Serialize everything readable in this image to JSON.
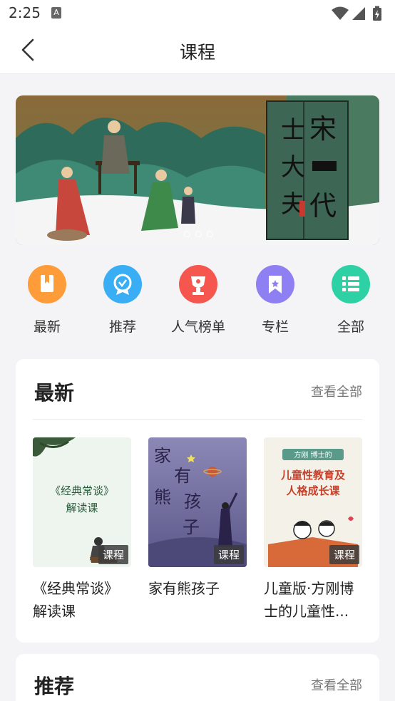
{
  "status": {
    "time": "2:25",
    "a_icon_label": "A"
  },
  "nav": {
    "title": "课程"
  },
  "banner": {
    "vertical_text_left": [
      "士",
      "大",
      "夫"
    ],
    "vertical_text_right": [
      "宋",
      "代"
    ]
  },
  "quicknav": [
    {
      "label": "最新",
      "icon": "book-icon",
      "color": "#ff9c3a"
    },
    {
      "label": "推荐",
      "icon": "badge-icon",
      "color": "#3aaef5"
    },
    {
      "label": "人气榜单",
      "icon": "trophy-icon",
      "color": "#f5564d"
    },
    {
      "label": "专栏",
      "icon": "bookmark-icon",
      "color": "#8e7ff2"
    },
    {
      "label": "全部",
      "icon": "list-icon",
      "color": "#2ed1a3"
    }
  ],
  "latest": {
    "title": "最新",
    "more": "查看全部",
    "books": [
      {
        "cover_text": "《经典常谈》解读课",
        "tag": "课程",
        "title": "《经典常谈》解读课"
      },
      {
        "cover_text": "家有熊孩子",
        "tag": "课程",
        "title": "家有熊孩子"
      },
      {
        "cover_top": "方刚 博士的",
        "cover_text": "儿童性教育及人格成长课",
        "tag": "课程",
        "title": "儿童版·方刚博士的儿童性..."
      }
    ]
  },
  "recommend": {
    "title": "推荐",
    "more": "查看全部"
  }
}
